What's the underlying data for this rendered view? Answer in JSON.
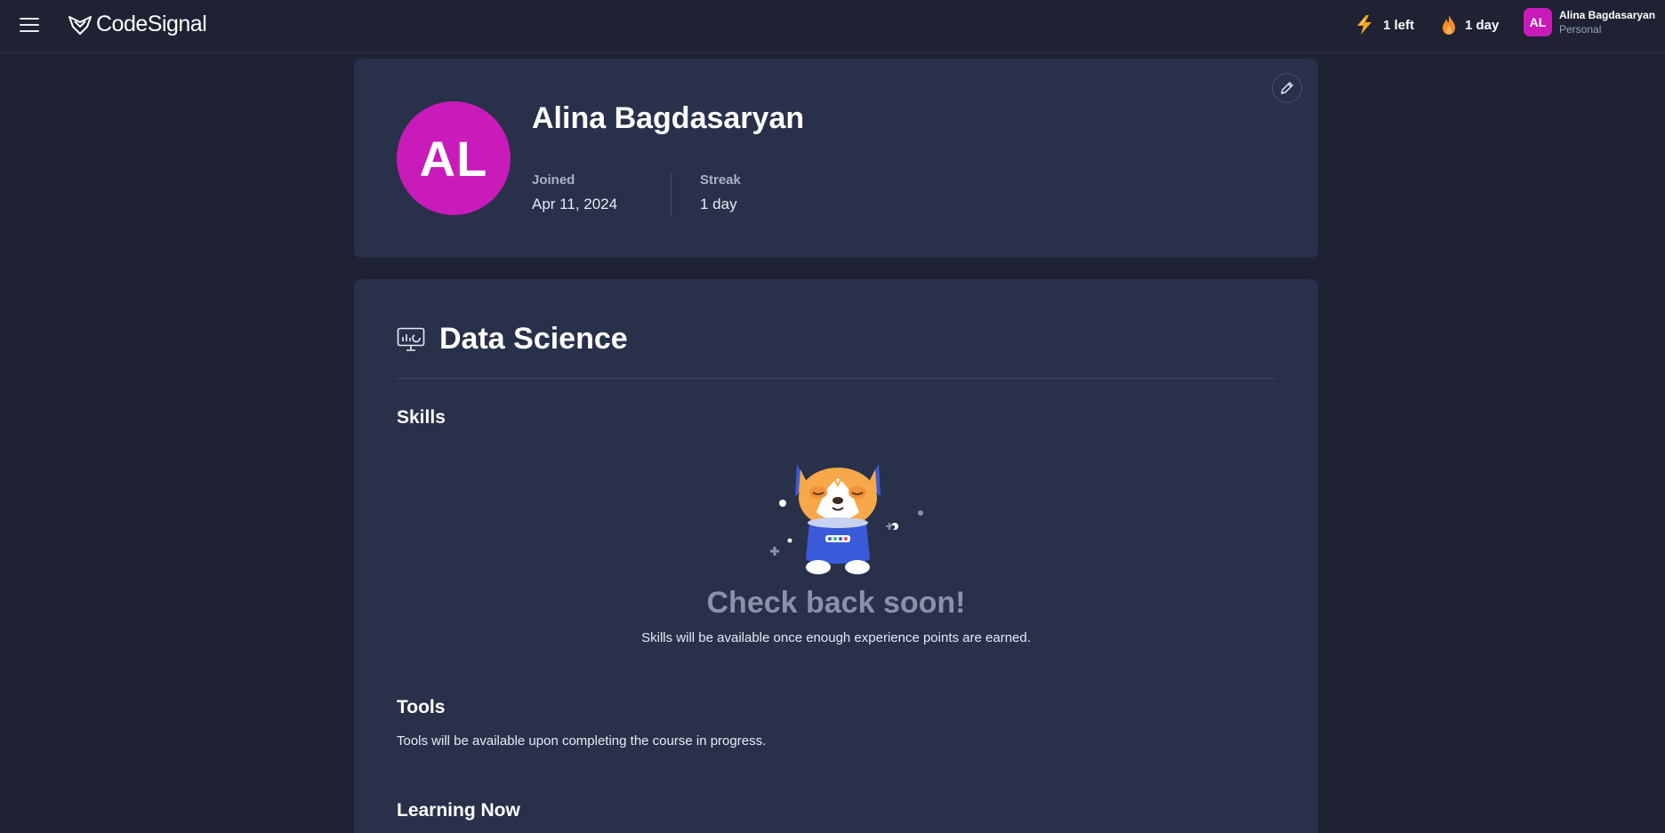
{
  "header": {
    "logo_text": "CodeSignal",
    "energy": {
      "icon": "lightning-icon",
      "label": "1 left"
    },
    "streak": {
      "icon": "flame-icon",
      "label": "1 day"
    },
    "user": {
      "initials": "AL",
      "name": "Alina Bagdasaryan",
      "plan": "Personal"
    }
  },
  "profile": {
    "initials": "AL",
    "name": "Alina Bagdasaryan",
    "joined_label": "Joined",
    "joined_value": "Apr 11, 2024",
    "streak_label": "Streak",
    "streak_value": "1 day"
  },
  "data_science": {
    "icon": "presentation-chart-icon",
    "title": "Data Science",
    "skills_title": "Skills",
    "empty_heading": "Check back soon!",
    "skills_description": "Skills will be available once enough experience points are earned.",
    "tools_title": "Tools",
    "tools_description": "Tools will be available upon completing the course in progress.",
    "learning_title": "Learning Now"
  },
  "colors": {
    "background": "#1e2233",
    "card": "#29304a",
    "avatar": "#c81bb9",
    "energy": "#f5a623",
    "flame": "#f28c28"
  }
}
